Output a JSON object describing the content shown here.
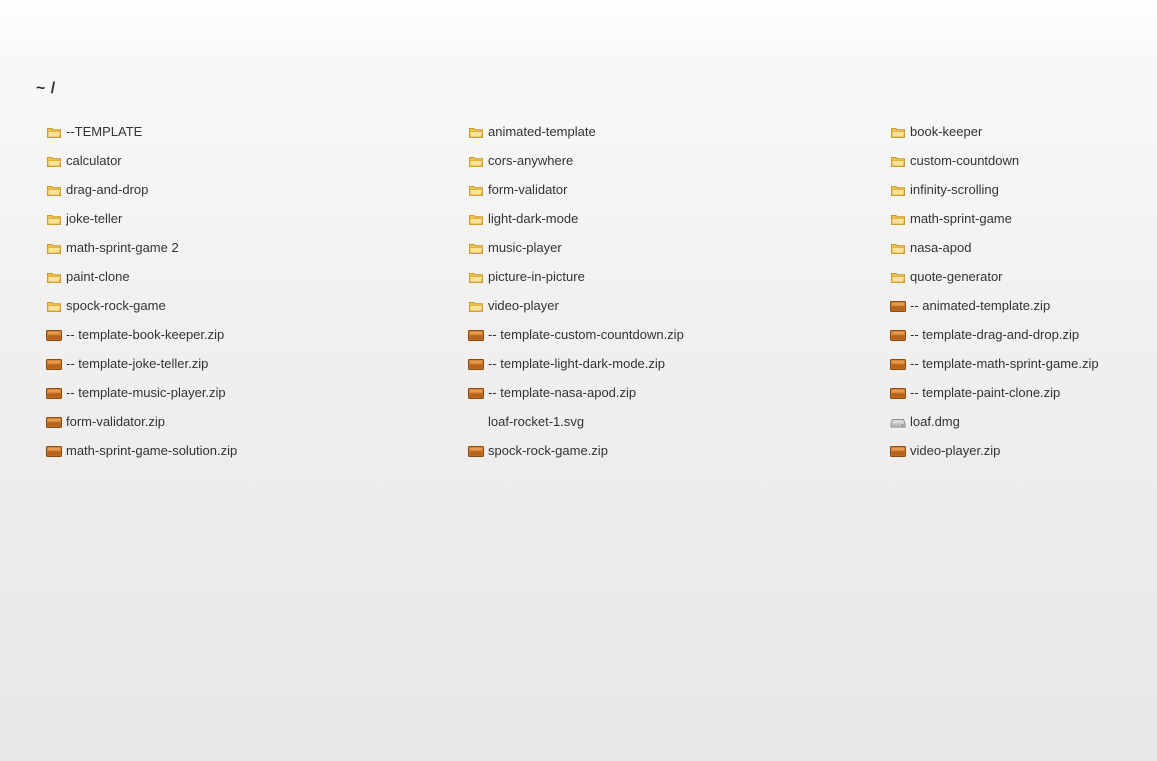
{
  "breadcrumb": "~ /",
  "entries": [
    {
      "name": "--TEMPLATE",
      "icon": "folder-icon"
    },
    {
      "name": "animated-template",
      "icon": "folder-icon"
    },
    {
      "name": "book-keeper",
      "icon": "folder-icon"
    },
    {
      "name": "calculator",
      "icon": "folder-icon"
    },
    {
      "name": "cors-anywhere",
      "icon": "folder-icon"
    },
    {
      "name": "custom-countdown",
      "icon": "folder-icon"
    },
    {
      "name": "drag-and-drop",
      "icon": "folder-icon"
    },
    {
      "name": "form-validator",
      "icon": "folder-icon"
    },
    {
      "name": "infinity-scrolling",
      "icon": "folder-icon"
    },
    {
      "name": "joke-teller",
      "icon": "folder-icon"
    },
    {
      "name": "light-dark-mode",
      "icon": "folder-icon"
    },
    {
      "name": "math-sprint-game",
      "icon": "folder-icon"
    },
    {
      "name": "math-sprint-game 2",
      "icon": "folder-icon"
    },
    {
      "name": "music-player",
      "icon": "folder-icon"
    },
    {
      "name": "nasa-apod",
      "icon": "folder-icon"
    },
    {
      "name": "paint-clone",
      "icon": "folder-icon"
    },
    {
      "name": "picture-in-picture",
      "icon": "folder-icon"
    },
    {
      "name": "quote-generator",
      "icon": "folder-icon"
    },
    {
      "name": "spock-rock-game",
      "icon": "folder-icon"
    },
    {
      "name": "video-player",
      "icon": "folder-icon"
    },
    {
      "name": "-- animated-template.zip",
      "icon": "archive-icon"
    },
    {
      "name": "-- template-book-keeper.zip",
      "icon": "archive-icon"
    },
    {
      "name": "-- template-custom-countdown.zip",
      "icon": "archive-icon"
    },
    {
      "name": "-- template-drag-and-drop.zip",
      "icon": "archive-icon"
    },
    {
      "name": "-- template-joke-teller.zip",
      "icon": "archive-icon"
    },
    {
      "name": "-- template-light-dark-mode.zip",
      "icon": "archive-icon"
    },
    {
      "name": "-- template-math-sprint-game.zip",
      "icon": "archive-icon"
    },
    {
      "name": "-- template-music-player.zip",
      "icon": "archive-icon"
    },
    {
      "name": "-- template-nasa-apod.zip",
      "icon": "archive-icon"
    },
    {
      "name": "-- template-paint-clone.zip",
      "icon": "archive-icon"
    },
    {
      "name": "form-validator.zip",
      "icon": "archive-icon"
    },
    {
      "name": "loaf-rocket-1.svg",
      "icon": "image-file-icon"
    },
    {
      "name": "loaf.dmg",
      "icon": "disk-image-icon"
    },
    {
      "name": "math-sprint-game-solution.zip",
      "icon": "archive-icon"
    },
    {
      "name": "spock-rock-game.zip",
      "icon": "archive-icon"
    },
    {
      "name": "video-player.zip",
      "icon": "archive-icon"
    }
  ]
}
